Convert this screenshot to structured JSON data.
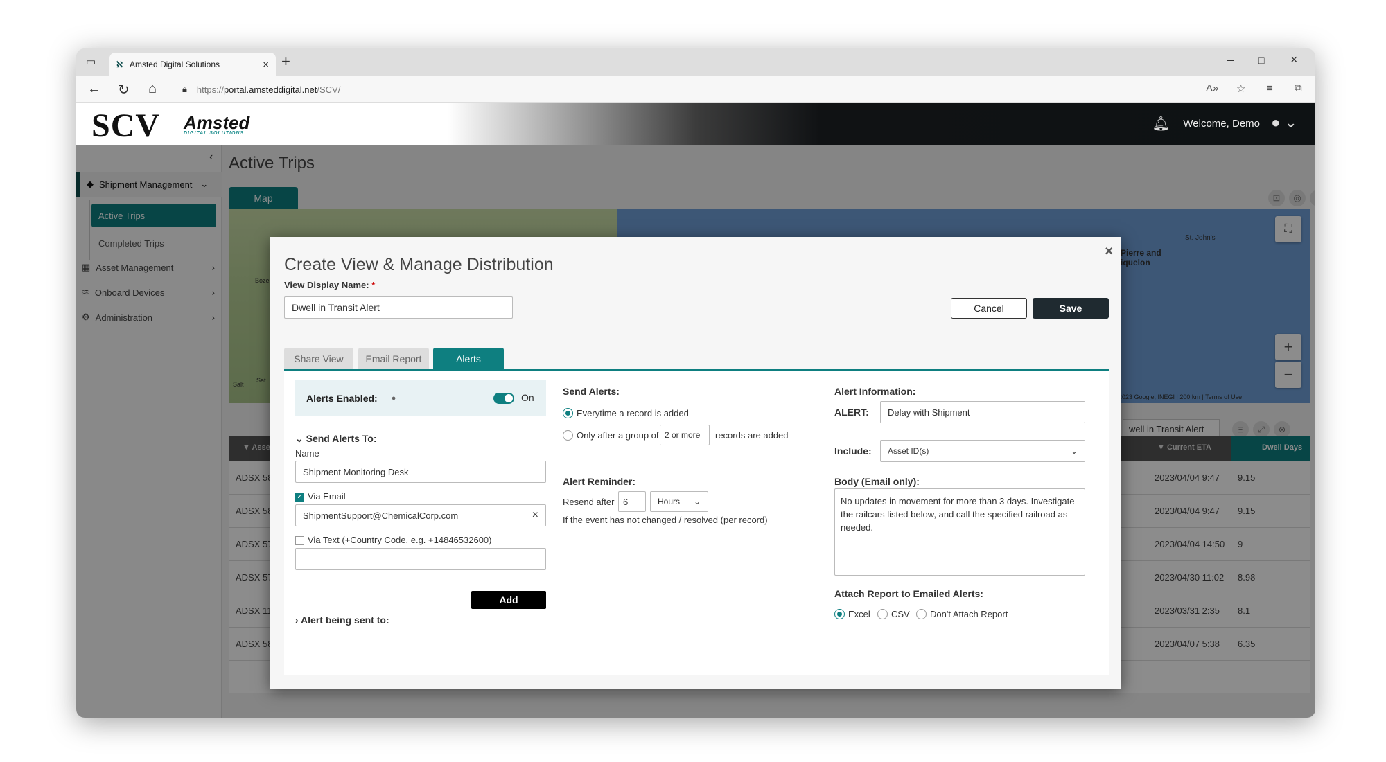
{
  "browser": {
    "tab_title": "Amsted Digital Solutions",
    "url_prefix": "https://",
    "url_host": "portal.amsteddigital.net",
    "url_path": "/SCV/"
  },
  "header": {
    "logo": "SCV",
    "brand": "Amsted",
    "brand_sub": "DIGITAL SOLUTIONS",
    "welcome": "Welcome, Demo"
  },
  "sidebar": {
    "shipment_management": "Shipment Management",
    "active_trips": "Active Trips",
    "completed_trips": "Completed Trips",
    "asset_management": "Asset Management",
    "onboard_devices": "Onboard Devices",
    "administration": "Administration"
  },
  "main": {
    "page_title": "Active Trips",
    "map_tab": "Map",
    "view_select": "well in Transit Alert"
  },
  "map": {
    "label_stjohns": "St. John's",
    "label_pierre": "Pierre and",
    "label_miquelon": "iquelon",
    "label_boze": "Boze",
    "label_salt": "Salt",
    "label_sat": "Sat",
    "attribution": "2023 Google, INEGI | 200 km | Terms of Use"
  },
  "grid": {
    "col_asset": "Asse",
    "col_eta": "Current ETA",
    "col_dwell": "Dwell Days",
    "rows": [
      {
        "asset": "ADSX 58",
        "eta": "2023/04/04 9:47",
        "dwell": "9.15"
      },
      {
        "asset": "ADSX 58",
        "eta": "2023/04/04 9:47",
        "dwell": "9.15"
      },
      {
        "asset": "ADSX 57",
        "eta": "2023/04/04 14:50",
        "dwell": "9"
      },
      {
        "asset": "ADSX 57",
        "eta": "2023/04/30 11:02",
        "dwell": "8.98"
      },
      {
        "asset": "ADSX 11",
        "eta": "2023/03/31 2:35",
        "dwell": "8.1"
      },
      {
        "asset": "ADSX 58",
        "eta": "2023/04/07 5:38",
        "dwell": "6.35"
      }
    ]
  },
  "modal": {
    "title": "Create View & Manage Distribution",
    "view_name_label": "View Display Name:",
    "required_mark": "*",
    "view_name_value": "Dwell in Transit Alert",
    "cancel": "Cancel",
    "save": "Save",
    "tabs": [
      "Share View",
      "Email Report",
      "Alerts"
    ],
    "alerts_enabled_label": "Alerts Enabled:",
    "toggle_state": "On",
    "send_alerts_to": "Send Alerts To:",
    "name_label": "Name",
    "name_value": "Shipment Monitoring Desk",
    "via_email": "Via Email",
    "email_value": "ShipmentSupport@ChemicalCorp.com",
    "via_text": "Via Text (+Country Code, e.g. +14846532600)",
    "text_value": "",
    "add": "Add",
    "alert_being_sent": "Alert being sent to:",
    "send_alerts": "Send Alerts:",
    "opt_every": "Everytime a record is added",
    "opt_group_pre": "Only after a group of",
    "opt_group_sel": "2 or more",
    "opt_group_post": "records are added",
    "reminder_label": "Alert Reminder:",
    "resend_after": "Resend after",
    "resend_value": "6",
    "resend_unit": "Hours",
    "reminder_note": "If the event has not changed / resolved (per record)",
    "alert_info": "Alert Information:",
    "alert_label": "ALERT:",
    "alert_value": "Delay with Shipment",
    "include_label": "Include:",
    "include_value": "Asset ID(s)",
    "body_label": "Body (Email only):",
    "body_value": "No updates in movement for more than 3 days. Investigate the railcars listed below, and call the specified railroad as needed.",
    "attach_label": "Attach Report to Emailed Alerts:",
    "attach_excel": "Excel",
    "attach_csv": "CSV",
    "attach_none": "Don't Attach Report"
  },
  "colors": {
    "accent": "#0e7f80",
    "dark": "#1f2a30"
  }
}
